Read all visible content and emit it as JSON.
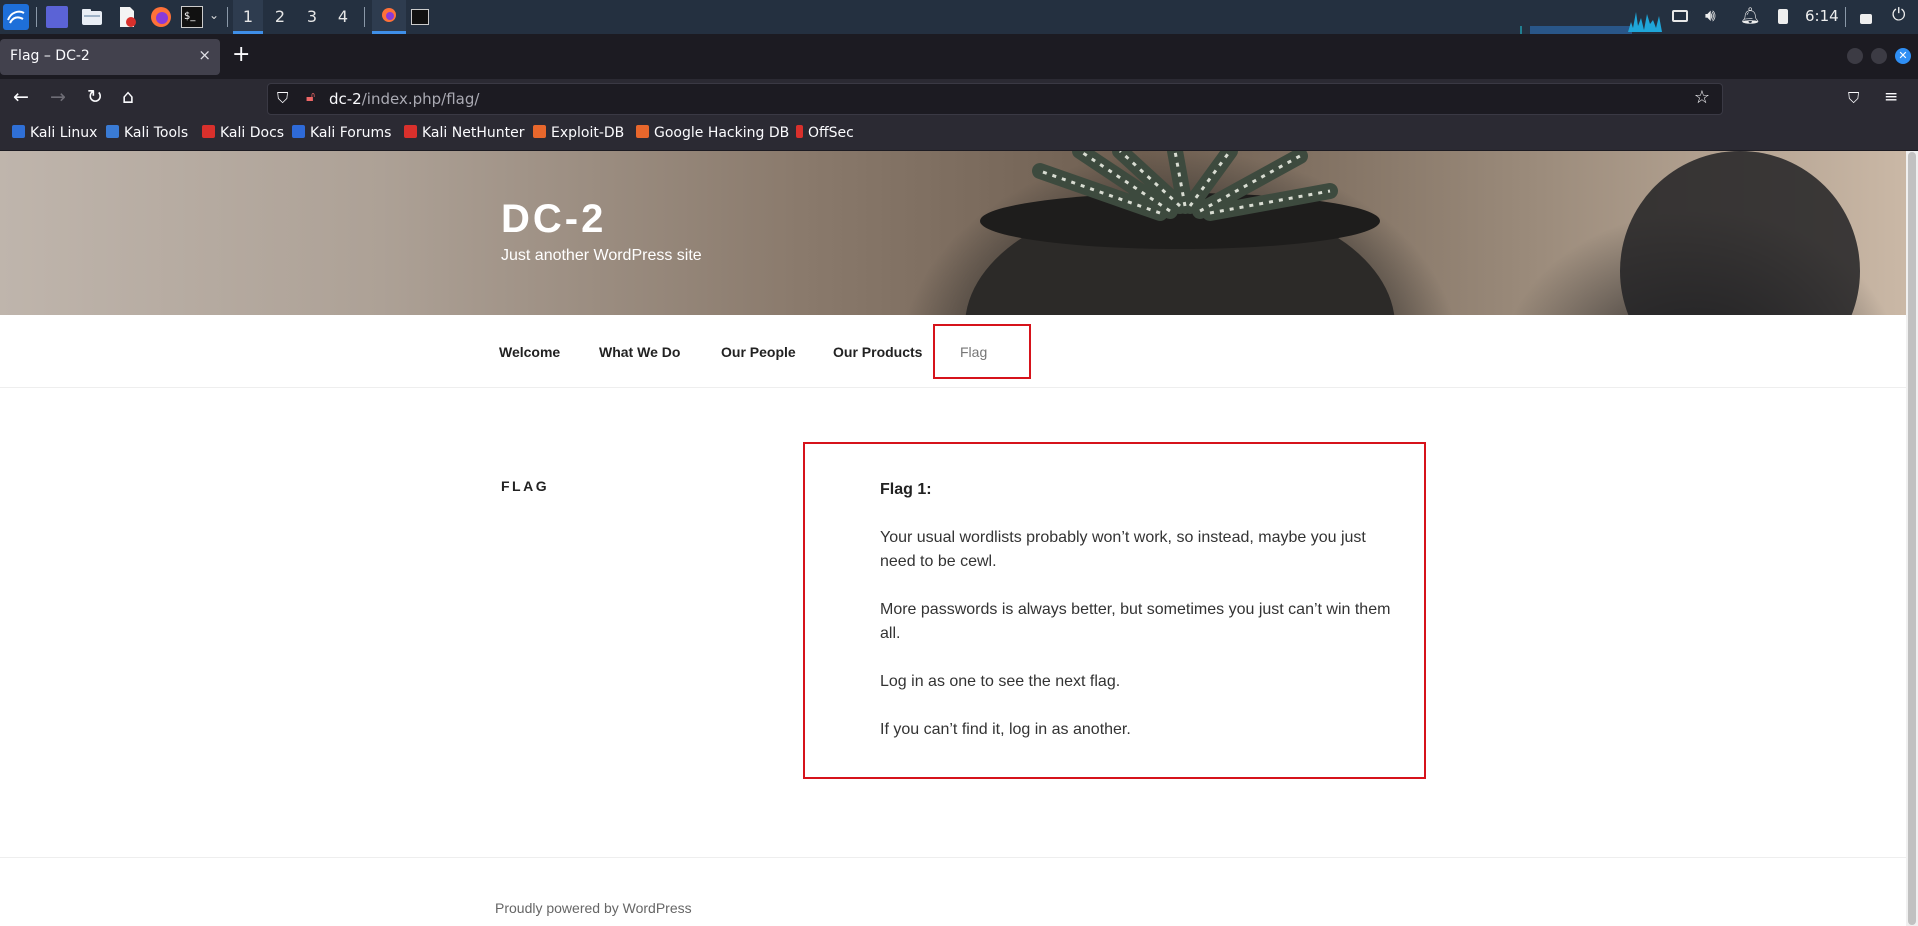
{
  "taskbar": {
    "workspaces": [
      "1",
      "2",
      "3",
      "4"
    ],
    "clock": "6:14"
  },
  "browser": {
    "tab_title": "Flag – DC-2",
    "tab_close": "×",
    "new_tab": "+",
    "url_host": "dc-2",
    "url_path": "/index.php/flag/"
  },
  "bookmarks": [
    {
      "label": "Kali Linux",
      "color": "#2f6fd6"
    },
    {
      "label": "Kali Tools",
      "color": "#3a7bd5"
    },
    {
      "label": "Kali Docs",
      "color": "#d9302c"
    },
    {
      "label": "Kali Forums",
      "color": "#2e6ad8"
    },
    {
      "label": "Kali NetHunter",
      "color": "#d9302c"
    },
    {
      "label": "Exploit-DB",
      "color": "#e8672c"
    },
    {
      "label": "Google Hacking DB",
      "color": "#e8672c"
    },
    {
      "label": "OffSec",
      "color": "#d9302c"
    }
  ],
  "site": {
    "title": "DC-2",
    "description": "Just another WordPress site"
  },
  "menu": [
    "Welcome",
    "What We Do",
    "Our People",
    "Our Products",
    "Flag"
  ],
  "entry": {
    "title": "FLAG",
    "heading": "Flag 1:",
    "paragraphs": [
      "Your usual wordlists probably won’t work, so instead, maybe you just need to be cewl.",
      "More passwords is always better, but sometimes you just can’t win them all.",
      "Log in as one to see the next flag.",
      "If you can’t find it, log in as another."
    ]
  },
  "footer": {
    "powered": "Proudly powered by WordPress"
  },
  "colors": {
    "highlight": "#d6131b",
    "panel": "#243040",
    "accent": "#3f8fe8"
  }
}
